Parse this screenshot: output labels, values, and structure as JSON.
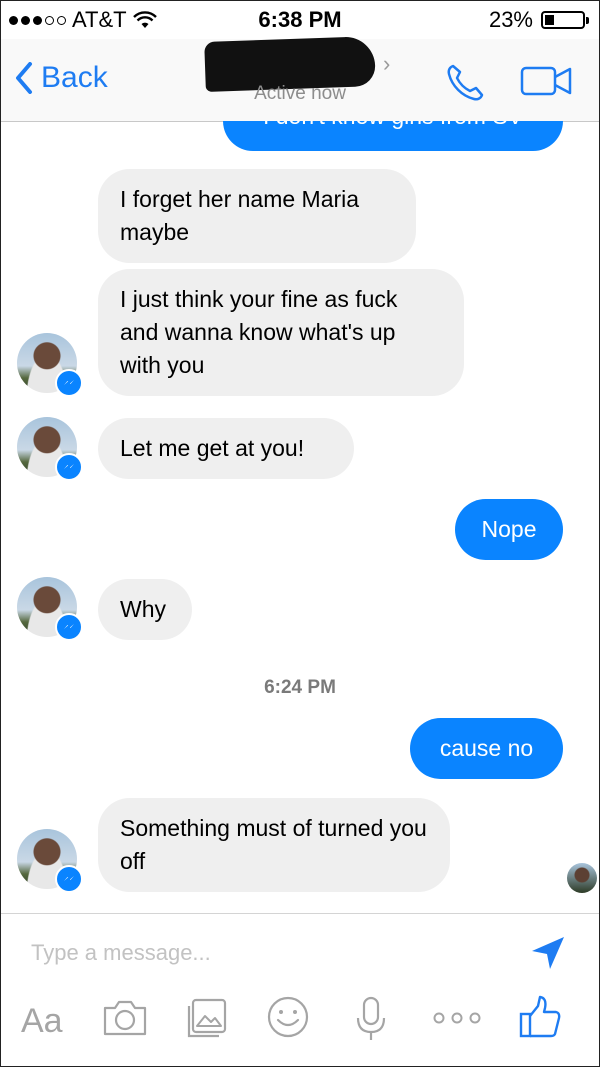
{
  "status": {
    "carrier": "AT&T",
    "time": "6:38 PM",
    "battery": "23%",
    "battery_level": 0.23
  },
  "header": {
    "back_label": "Back",
    "subtitle": "Active now"
  },
  "messages": {
    "clipped_out": "I don't know girls from SV",
    "in_1": "I forget her name Maria maybe",
    "in_2": "I just think your fine as fuck and wanna know what's up with you",
    "in_3": "Let me get at you!",
    "out_1": "Nope",
    "in_4": "Why",
    "timestamp": "6:24 PM",
    "out_2": "cause no",
    "in_5": "Something must of turned you off"
  },
  "composer": {
    "placeholder": "Type a message...",
    "aa_label": "Aa"
  },
  "colors": {
    "accent": "#1e7cf2",
    "outgoing_bubble": "#0a84ff",
    "incoming_bubble": "#efefef"
  }
}
